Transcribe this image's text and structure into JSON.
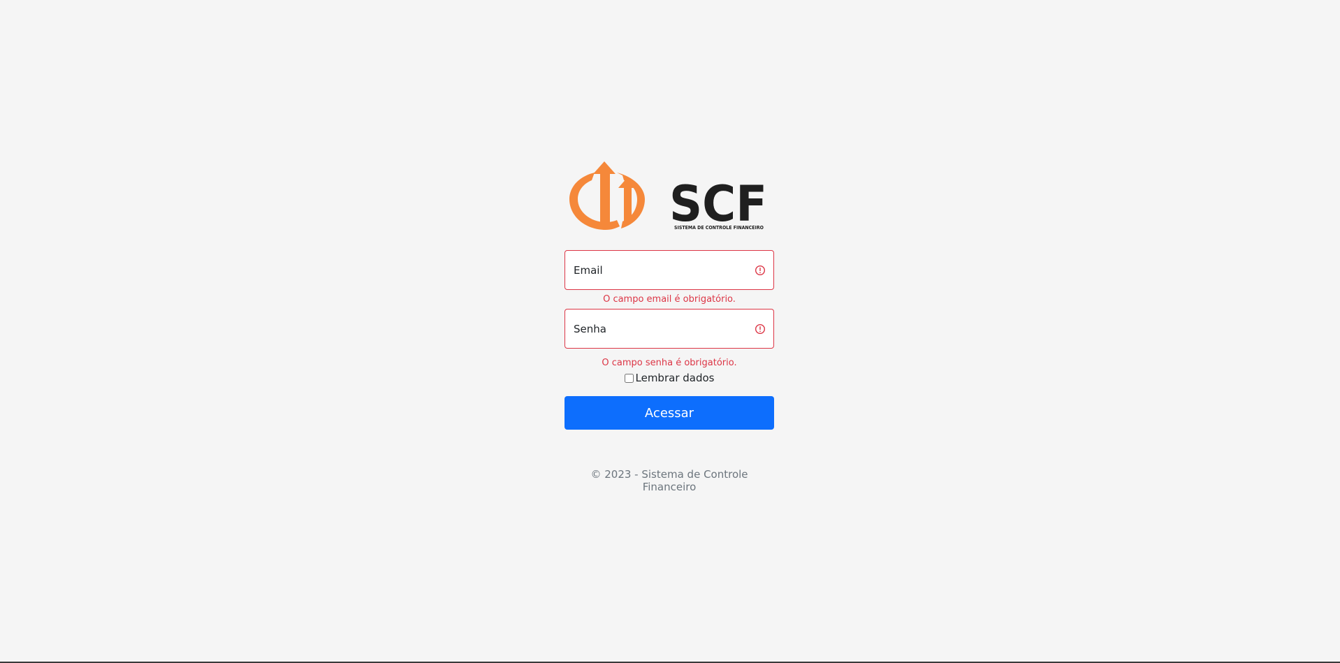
{
  "logo": {
    "brand_text": "SCF",
    "brand_subtitle": "SISTEMA DE CONTROLE FINANCEIRO",
    "icon": "orange-arrows-circle-logo",
    "accent_color": "#f5883a"
  },
  "form": {
    "email": {
      "placeholder": "Email",
      "value": "",
      "error": "O campo email é obrigatório."
    },
    "senha": {
      "placeholder": "Senha",
      "value": "",
      "error": "O campo senha é obrigatório."
    },
    "remember_label": "Lembrar dados",
    "remember_checked": false,
    "submit_label": "Acessar"
  },
  "footer": {
    "text": "© 2023 - Sistema de Controle Financeiro"
  },
  "colors": {
    "background": "#f5f5f5",
    "error": "#dc3545",
    "primary": "#0d6efd",
    "muted": "#6c757d"
  }
}
